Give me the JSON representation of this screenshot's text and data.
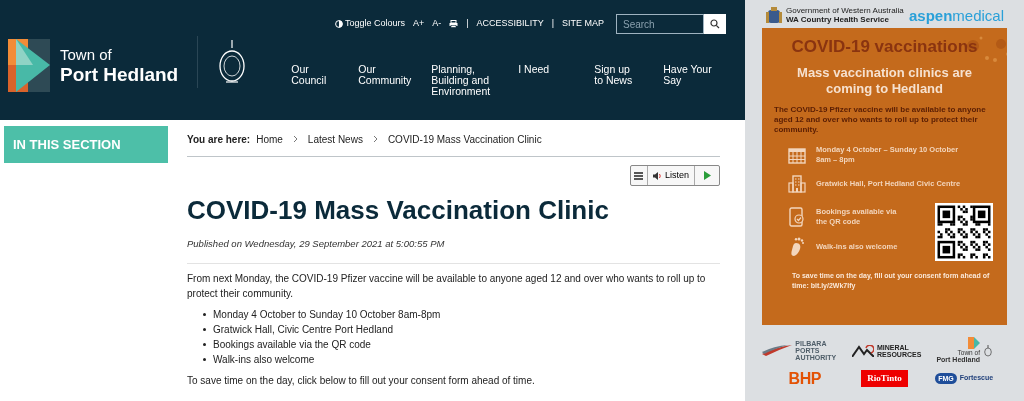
{
  "header": {
    "logo": {
      "line1": "Town of",
      "line2": "Port Hedland"
    },
    "utility_links": [
      {
        "kind": "toggle",
        "label": "Toggle Colours"
      },
      {
        "kind": "link",
        "label": "A+"
      },
      {
        "kind": "link",
        "label": "A-"
      },
      {
        "kind": "print"
      },
      {
        "kind": "separator",
        "label": "|"
      },
      {
        "kind": "link",
        "label": "ACCESSIBILITY"
      },
      {
        "kind": "separator",
        "label": "|"
      },
      {
        "kind": "link",
        "label": "SITE MAP"
      }
    ],
    "search": {
      "placeholder": "Search"
    },
    "nav": [
      "Our\nCouncil",
      "Our\nCommunity",
      "Planning,\nBuilding and\nEnvironment",
      "I Need",
      "Sign up\nto News",
      "Have Your\nSay"
    ]
  },
  "sidebar": {
    "section_title": "IN THIS SECTION"
  },
  "breadcrumb": {
    "label": "You are here:",
    "items": [
      "Home",
      "Latest News",
      "COVID-19 Mass Vaccination Clinic"
    ]
  },
  "listen": {
    "label": "Listen"
  },
  "article": {
    "title": "COVID-19 Mass Vaccination Clinic",
    "published": "Published on Wednesday, 29 September 2021 at 5:00:55 PM",
    "intro": "From next Monday, the COVID-19 Pfizer vaccine will be available to anyone aged 12 and over who wants to roll up to protect their community.",
    "bullets": [
      "Monday 4 October to Sunday 10 October 8am-8pm",
      "Gratwick Hall, Civic Centre Port Hedland",
      "Bookings available via the QR code",
      "Walk-ins also welcome"
    ],
    "outro": "To save time on the day, click below to fill out your consent form ahead of time."
  },
  "poster": {
    "gov_line1": "Government of Western Australia",
    "gov_line2": "WA Country Health Service",
    "brand_bold": "aspen",
    "brand_light": "medical",
    "title": "COVID-19 vaccinations",
    "subtitle": "Mass vaccination clinics are coming to Hedland",
    "intro": "The COVID-19 Pfizer vaccine will be available to anyone aged 12 and over who wants to roll up to protect their community.",
    "items": [
      {
        "kind": "calendar",
        "text": "Monday 4 October – Sunday 10 October 8am – 8pm"
      },
      {
        "kind": "building",
        "text": "Gratwick Hall, Port Hedland Civic Centre"
      },
      {
        "kind": "phone",
        "text": "Bookings available via the QR code"
      },
      {
        "kind": "footprint",
        "text": "Walk-ins also welcome"
      }
    ],
    "consent": "To save time on the day, fill out your consent form ahead of time: bit.ly/2Wk7Ify",
    "sponsors": [
      {
        "kind": "ports",
        "label": "PILBARA PORTS AUTHORITY"
      },
      {
        "kind": "mineral",
        "label": "MINERAL RESOURCES"
      },
      {
        "kind": "town",
        "label1": "Town of",
        "label2": "Port Hedland"
      },
      {
        "kind": "bhp",
        "label": "BHP"
      },
      {
        "kind": "riotinto",
        "label": "RioTinto"
      },
      {
        "kind": "fortescue",
        "label1": "FMG",
        "label2": "Fortescue"
      }
    ]
  }
}
